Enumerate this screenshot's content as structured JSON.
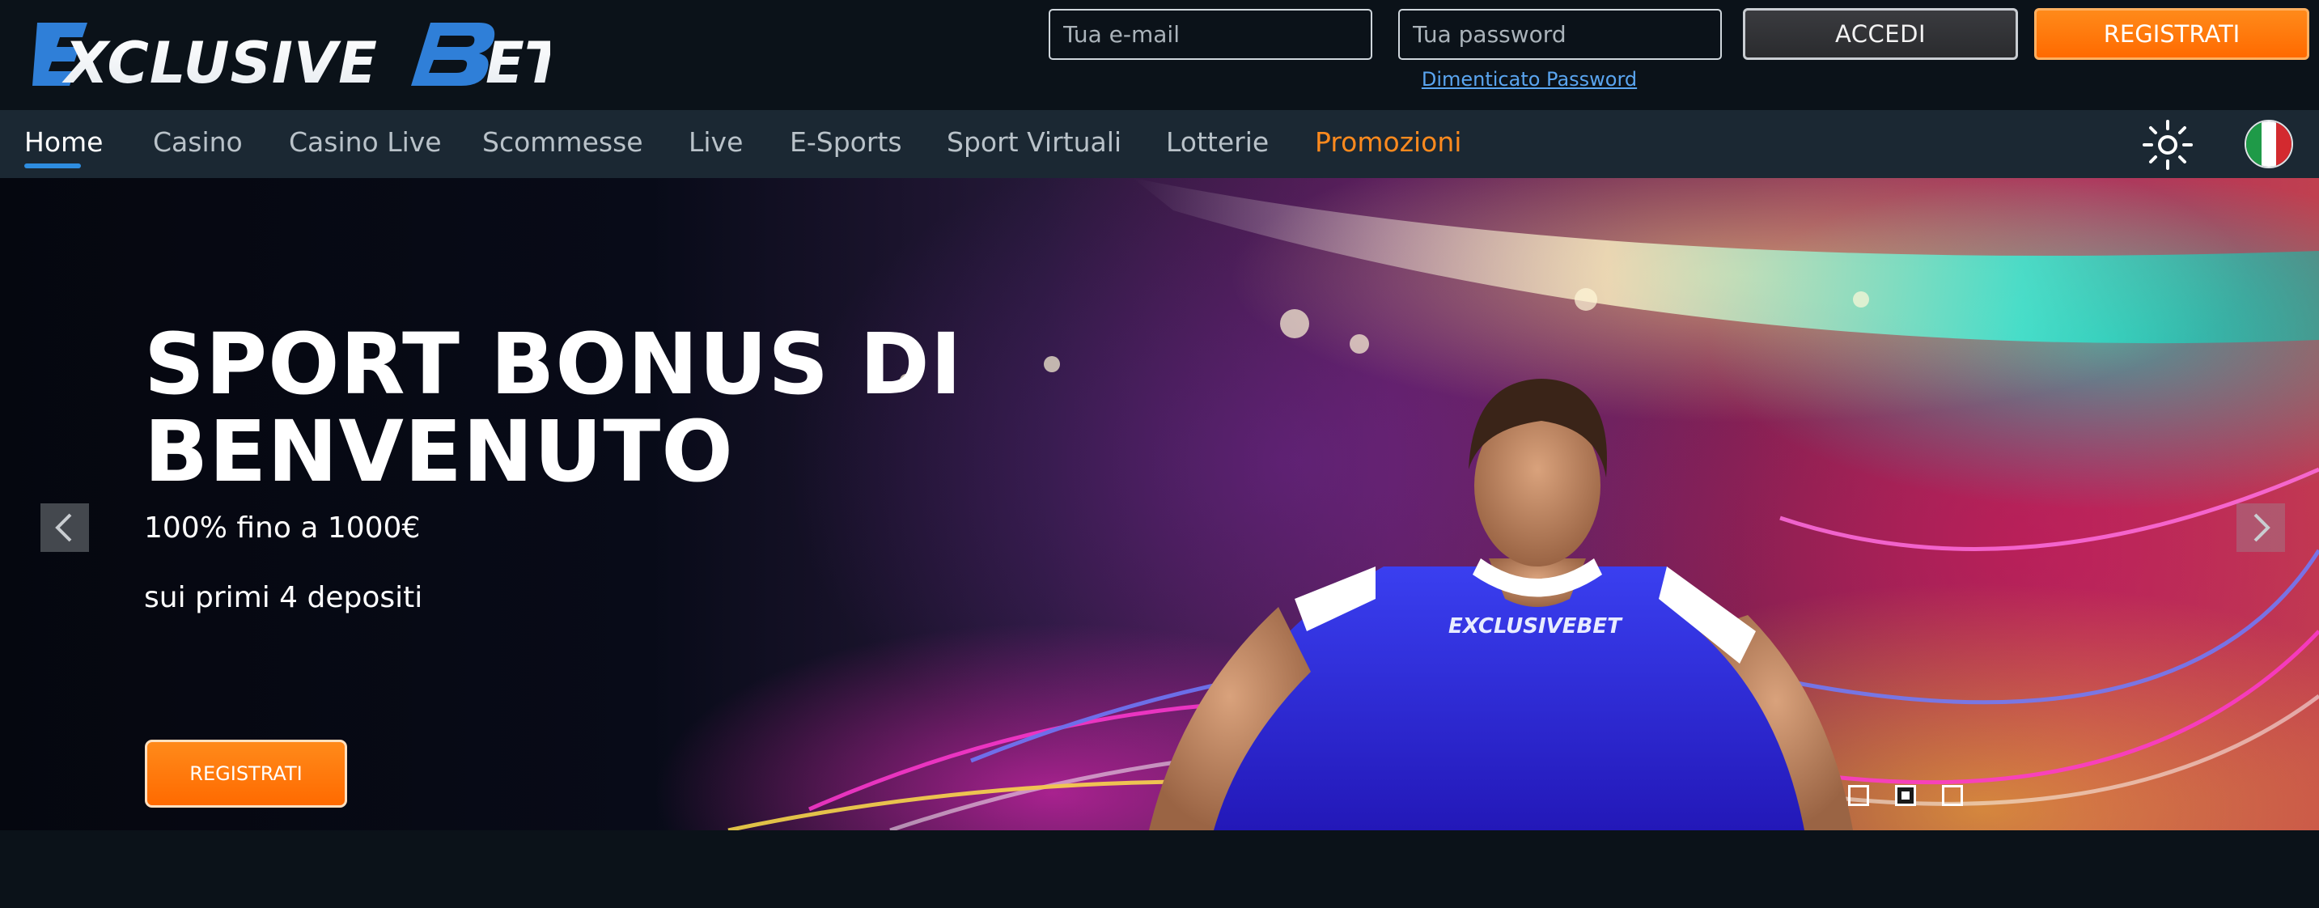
{
  "brand": {
    "logo_text": "EXCLUSIVEBET"
  },
  "login": {
    "email_placeholder": "Tua e-mail",
    "password_placeholder": "Tua password",
    "forgot_label": "Dimenticato Password",
    "login_label": "ACCEDI",
    "register_label": "REGISTRATI"
  },
  "nav": {
    "items": [
      {
        "label": "Home",
        "state": "active"
      },
      {
        "label": "Casino"
      },
      {
        "label": "Casino Live"
      },
      {
        "label": "Scommesse"
      },
      {
        "label": "Live"
      },
      {
        "label": "E-Sports"
      },
      {
        "label": "Sport Virtuali"
      },
      {
        "label": "Lotterie"
      },
      {
        "label": "Promozioni",
        "state": "highlight"
      }
    ],
    "theme_icon": "sun-icon",
    "language_icon": "italian-flag-icon"
  },
  "hero": {
    "title": "SPORT BONUS DI BENVENUTO",
    "subtitle_1": "100% fino a 1000€",
    "subtitle_2": "sui primi 4 depositi",
    "cta_label": "REGISTRATI",
    "jersey_text": "EXCLUSIVEBET",
    "prev_icon": "chevron-left-icon",
    "next_icon": "chevron-right-icon",
    "slides_total": 3,
    "active_slide": 2
  },
  "colors": {
    "background": "#0b1219",
    "navbar": "#1b2833",
    "accent_orange": "#ff7a10",
    "link_blue": "#5aa5f0",
    "active_underline": "#2e8de0",
    "logo_blue": "#2f7fd8"
  }
}
